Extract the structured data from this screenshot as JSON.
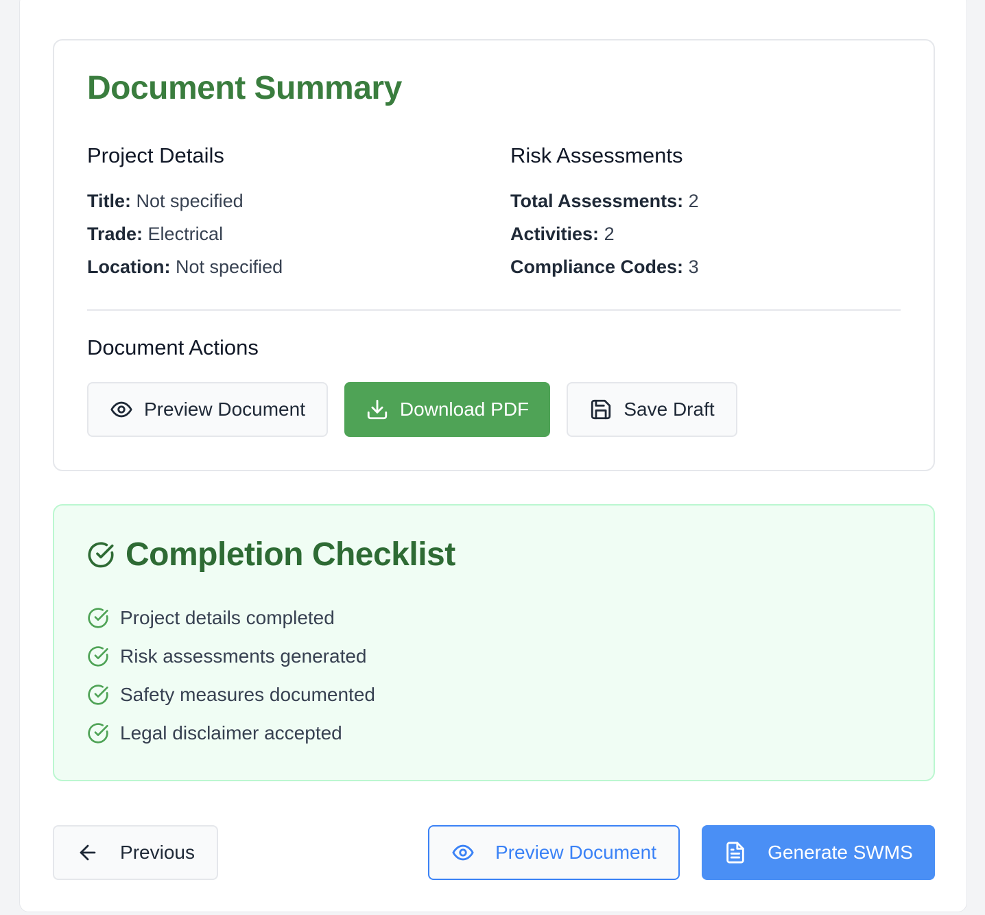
{
  "summary": {
    "title": "Document Summary",
    "project_details": {
      "heading": "Project Details",
      "rows": [
        {
          "label": "Title:",
          "value": "Not specified"
        },
        {
          "label": "Trade:",
          "value": "Electrical"
        },
        {
          "label": "Location:",
          "value": "Not specified"
        }
      ]
    },
    "risk_assessments": {
      "heading": "Risk Assessments",
      "rows": [
        {
          "label": "Total Assessments:",
          "value": "2"
        },
        {
          "label": "Activities:",
          "value": "2"
        },
        {
          "label": "Compliance Codes:",
          "value": "3"
        }
      ]
    },
    "actions": {
      "heading": "Document Actions",
      "preview_label": "Preview Document",
      "download_label": "Download PDF",
      "save_label": "Save Draft"
    }
  },
  "checklist": {
    "title": "Completion Checklist",
    "items": [
      {
        "label": "Project details completed",
        "icon": "check-circle-icon"
      },
      {
        "label": "Risk assessments generated",
        "icon": "check-circle-icon"
      },
      {
        "label": "Safety measures documented",
        "icon": "check-circle-icon"
      },
      {
        "label": "Legal disclaimer accepted",
        "icon": "check-circle-icon"
      }
    ]
  },
  "footer": {
    "previous_label": "Previous",
    "preview_label": "Preview Document",
    "generate_label": "Generate SWMS"
  },
  "colors": {
    "green_heading": "#3a7d3e",
    "green_button": "#4fa356",
    "checklist_bg": "#f0fdf4",
    "blue_accent": "#3b82f6"
  }
}
